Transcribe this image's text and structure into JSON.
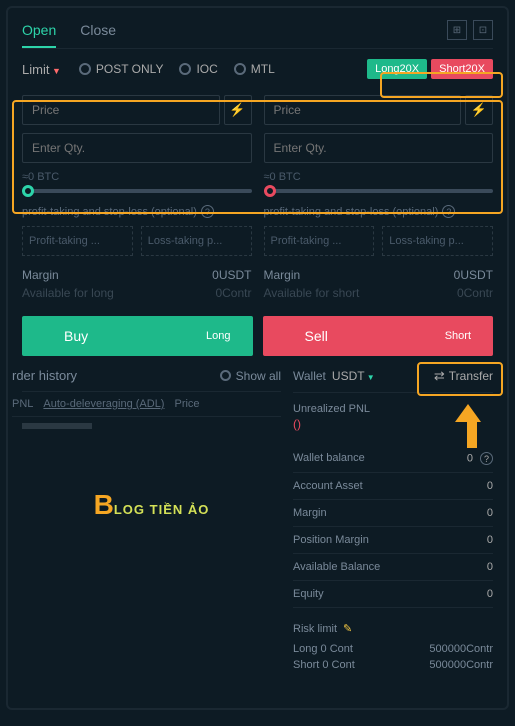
{
  "tabs": {
    "open": "Open",
    "close": "Close"
  },
  "orderType": {
    "limit": "Limit",
    "postOnly": "POST ONLY",
    "ioc": "IOC",
    "mtl": "MTL"
  },
  "leverage": {
    "long": "Long20X",
    "short": "Short20X"
  },
  "buySide": {
    "pricePh": "Price",
    "qtyPh": "Enter Qty.",
    "approx": "≈0 BTC",
    "tpslLabel": "profit-taking and stop-loss (optional)",
    "profitBtn": "Profit-taking ...",
    "lossBtn": "Loss-taking p...",
    "marginLabel": "Margin",
    "marginVal": "0USDT",
    "availLabel": "Available for long",
    "availVal": "0Contr"
  },
  "sellSide": {
    "pricePh": "Price",
    "qtyPh": "Enter Qty.",
    "approx": "≈0 BTC",
    "tpslLabel": "profit-taking and stop-loss (optional)",
    "profitBtn": "Profit-taking ...",
    "lossBtn": "Loss-taking p...",
    "marginLabel": "Margin",
    "marginVal": "0USDT",
    "availLabel": "Available for short",
    "availVal": "0Contr"
  },
  "buttons": {
    "buy": "Buy",
    "long": "Long",
    "sell": "Sell",
    "short": "Short"
  },
  "history": {
    "title": "rder history",
    "showAll": "Show all",
    "pnl": "PNL",
    "adl": "Auto-deleveraging (ADL)",
    "price": "Price"
  },
  "logo": {
    "b": "B",
    "text": "LOG TIỀN ẢO"
  },
  "wallet": {
    "label": "Wallet",
    "currency": "USDT",
    "transfer": "Transfer",
    "unrealized": "Unrealized PNL",
    "unrealizedVal": "()",
    "rows": {
      "balance": {
        "label": "Wallet balance",
        "val": "0"
      },
      "asset": {
        "label": "Account Asset",
        "val": "0"
      },
      "margin": {
        "label": "Margin",
        "val": "0"
      },
      "posMargin": {
        "label": "Position Margin",
        "val": "0"
      },
      "available": {
        "label": "Available Balance",
        "val": "0"
      },
      "equity": {
        "label": "Equity",
        "val": "0"
      }
    },
    "risk": {
      "label": "Risk limit",
      "long": {
        "label": "Long 0 Cont",
        "val": "500000Contr"
      },
      "short": {
        "label": "Short 0 Cont",
        "val": "500000Contr"
      }
    }
  }
}
